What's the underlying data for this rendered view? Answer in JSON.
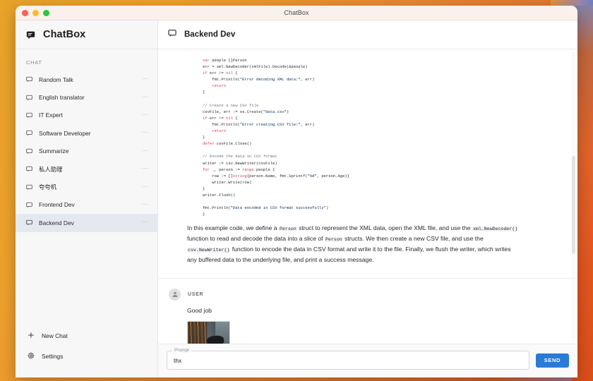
{
  "window": {
    "title": "ChatBox",
    "traffic_lights": [
      "close-red",
      "minimize-yellow",
      "maximize-green"
    ]
  },
  "sidebar": {
    "brand": "ChatBox",
    "brand_icon": "chat-bubble-icon",
    "section_label": "CHAT",
    "items": [
      {
        "label": "Random Talk",
        "icon": "chat-bubble-icon",
        "menu": "···",
        "selected": false
      },
      {
        "label": "English translator",
        "icon": "chat-bubble-icon",
        "menu": "···",
        "selected": false
      },
      {
        "label": "IT Expert",
        "icon": "chat-bubble-icon",
        "menu": "···",
        "selected": false
      },
      {
        "label": "Software Developer",
        "icon": "chat-bubble-icon",
        "menu": "···",
        "selected": false
      },
      {
        "label": "Summarize",
        "icon": "chat-bubble-icon",
        "menu": "···",
        "selected": false
      },
      {
        "label": "私人助理",
        "icon": "chat-bubble-icon",
        "menu": "···",
        "selected": false
      },
      {
        "label": "夸夸机",
        "icon": "chat-bubble-icon",
        "menu": "···",
        "selected": false
      },
      {
        "label": "Frontend Dev",
        "icon": "chat-bubble-icon",
        "menu": "···",
        "selected": false
      },
      {
        "label": "Backend Dev",
        "icon": "chat-bubble-icon",
        "menu": "···",
        "selected": true
      }
    ],
    "actions": [
      {
        "label": "New Chat",
        "icon": "plus-icon"
      },
      {
        "label": "Settings",
        "icon": "gear-icon"
      }
    ]
  },
  "main": {
    "header": {
      "icon": "chat-bubble-icon",
      "title": "Backend Dev"
    },
    "assistant_message": {
      "code_language": "go",
      "code_lines": [
        "var people []Person",
        "err = xml.NewDecoder(xmlFile).Decode(&people)",
        "if err != nil {",
        "    fmt.Println(\"Error decoding XML data:\", err)",
        "    return",
        "}",
        "",
        "// Create a new CSV file",
        "csvFile, err := os.Create(\"data.csv\")",
        "if err != nil {",
        "    fmt.Println(\"Error creating CSV file:\", err)",
        "    return",
        "}",
        "defer csvFile.Close()",
        "",
        "// Encode the data in CSV format",
        "writer := csv.NewWriter(csvFile)",
        "for _, person := range people {",
        "    row := []string{person.Name, fmt.Sprintf(\"%d\", person.Age)}",
        "    writer.Write(row)",
        "}",
        "writer.Flush()",
        "",
        "fmt.Println(\"Data encoded in CSV format successfully\")",
        "}"
      ],
      "paragraph_parts": [
        {
          "type": "text",
          "text": "In this example code, we define a "
        },
        {
          "type": "code",
          "text": "Person"
        },
        {
          "type": "text",
          "text": " struct to represent the XML data, open the XML file, and use the "
        },
        {
          "type": "code",
          "text": "xml.NewDecoder()"
        },
        {
          "type": "text",
          "text": " function to read and decode the data into a slice of "
        },
        {
          "type": "code",
          "text": "Person"
        },
        {
          "type": "text",
          "text": " structs. We then create a new CSV file, and use the "
        },
        {
          "type": "code",
          "text": "csv.NewWriter()"
        },
        {
          "type": "text",
          "text": " function to encode the data in CSV format and write it to the file. Finally, we flush the writer, which writes any buffered data to the underlying file, and print a success message."
        }
      ]
    },
    "user_message": {
      "role_label": "USER",
      "avatar_icon": "user-avatar-icon",
      "text": "Good job",
      "attachment": {
        "type": "image",
        "alt": "photo of a man in a cap giving a thumbs up"
      }
    }
  },
  "composer": {
    "field_label": "Prompt",
    "value": "thx",
    "placeholder": "",
    "send_label": "SEND"
  },
  "colors": {
    "accent_blue": "#2a7bd4",
    "sidebar_bg": "#f7f7f8",
    "selected_item_bg": "#e4e9f0",
    "code_keyword": "#d73a49",
    "code_string": "#032f62",
    "code_comment": "#6a737d",
    "desktop_orange": "#e2642a"
  }
}
